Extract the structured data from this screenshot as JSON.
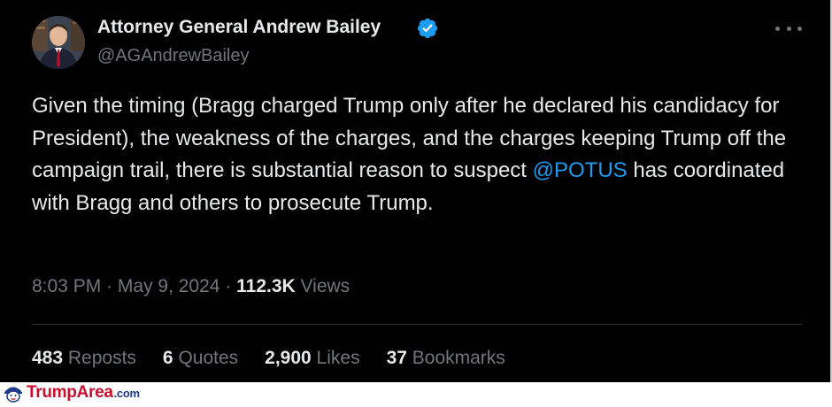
{
  "tweet": {
    "author": {
      "display_name": "Attorney General Andrew Bailey",
      "handle": "@AGAndrewBailey",
      "verified": true,
      "verified_color": "#1d9bf0"
    },
    "text": {
      "part1": "Given the timing (Bragg charged Trump only after he declared his candidacy for President), the weakness of the charges, and the charges keeping Trump off the campaign trail, there is substantial reason to suspect ",
      "mention": "@POTUS",
      "part2": " has coordinated with Bragg and others to prosecute Trump."
    },
    "meta": {
      "time": "8:03 PM",
      "separator": " · ",
      "date": "May 9, 2024",
      "views_count": "112.3K",
      "views_label": " Views"
    },
    "stats": {
      "reposts": {
        "count": "483",
        "label": " Reposts"
      },
      "quotes": {
        "count": "6",
        "label": " Quotes"
      },
      "likes": {
        "count": "2,900",
        "label": " Likes"
      },
      "bookmarks": {
        "count": "37",
        "label": " Bookmarks"
      }
    },
    "colors": {
      "background": "#000000",
      "text_primary": "#e7e9ea",
      "text_secondary": "#71767b",
      "link": "#1d9bf0"
    }
  },
  "watermark": {
    "brand": "TrumpArea",
    "tld": ".com",
    "brand_color": "#c8102e"
  }
}
